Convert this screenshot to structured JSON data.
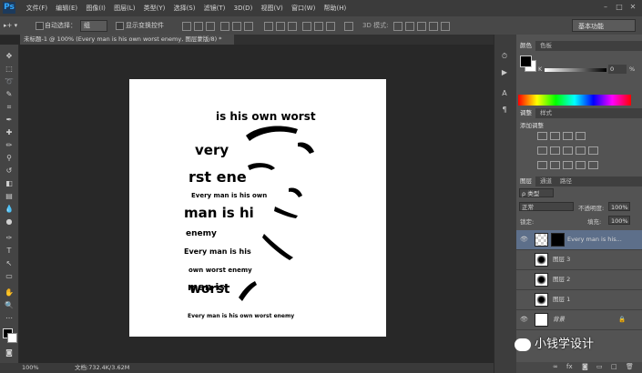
{
  "app": {
    "logo": "Ps"
  },
  "menu": [
    "文件(F)",
    "编辑(E)",
    "图像(I)",
    "图层(L)",
    "类型(Y)",
    "选择(S)",
    "滤镜(T)",
    "3D(D)",
    "视图(V)",
    "窗口(W)",
    "帮助(H)"
  ],
  "options": {
    "auto_select_label": "自动选择：",
    "auto_select_value": "组",
    "show_transform_label": "显示变换控件",
    "workspace": "基本功能"
  },
  "document": {
    "tab_title": "未标题-1 @ 100% (Every man is his own worst enemy, 图层蒙版/8) *",
    "status_zoom": "100%",
    "status_doc": "文档:732.4K/3.62M",
    "artwork_text": [
      "is his own worst",
      "very",
      "rst ene",
      "Every man is his own",
      "man is hi",
      "enemy",
      "Every man is his",
      "own worst enemy",
      "man is",
      "worst",
      "Every man is his own worst enemy"
    ]
  },
  "panels": {
    "color_tabs": [
      "颜色",
      "色板"
    ],
    "k_label": "K",
    "k_value": "0",
    "k_unit": "%",
    "adjust_tabs": [
      "调整",
      "样式"
    ],
    "adjust_title": "添加调整",
    "layers_tabs": [
      "图层",
      "通道",
      "路径"
    ],
    "filter_kind": "ρ 类型",
    "blend_mode": "正常",
    "opacity_label": "不透明度:",
    "opacity_value": "100%",
    "lock_label": "锁定:",
    "fill_label": "填充:",
    "fill_value": "100%",
    "layers": [
      {
        "name": "Every man is his...",
        "selected": true
      },
      {
        "name": "图层 3",
        "selected": false
      },
      {
        "name": "图层 2",
        "selected": false
      },
      {
        "name": "图层 1",
        "selected": false
      },
      {
        "name": "背景",
        "selected": false
      }
    ]
  },
  "watermark": "小钱学设计",
  "colors": {
    "accent": "#31a8ff",
    "panel": "#535353",
    "selected_layer": "#5d6f8a"
  }
}
